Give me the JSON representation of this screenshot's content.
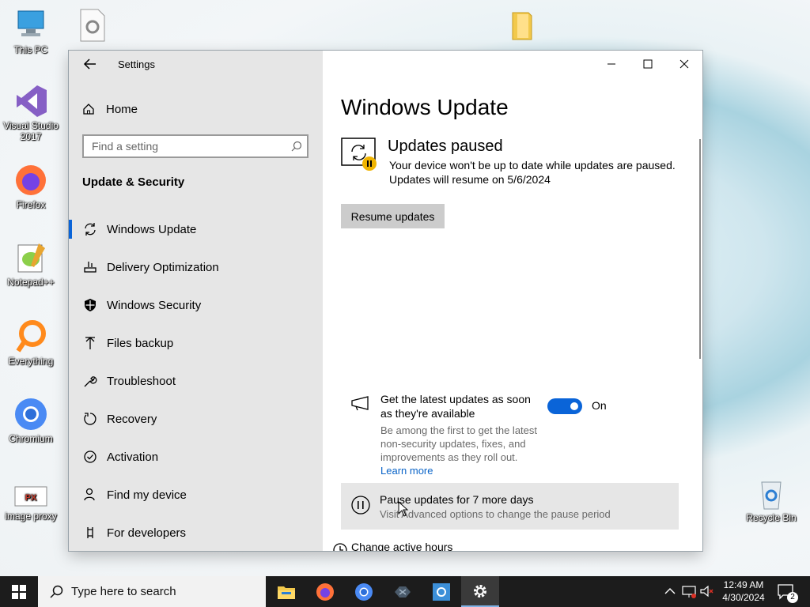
{
  "desktop": {
    "icons": [
      {
        "label": "This PC"
      },
      {
        "label": "Visual Studio 2017"
      },
      {
        "label": "Firefox"
      },
      {
        "label": "Notepad++"
      },
      {
        "label": "Everything"
      },
      {
        "label": "Chromium"
      },
      {
        "label": "image proxy"
      },
      {
        "label": "Recycle Bin"
      }
    ]
  },
  "window": {
    "title": "Settings",
    "controls": {
      "minimize": "minimize-icon",
      "maximize": "maximize-icon",
      "close": "close-icon"
    }
  },
  "sidebar": {
    "home_label": "Home",
    "search_placeholder": "Find a setting",
    "section_title": "Update & Security",
    "items": [
      {
        "label": "Windows Update",
        "icon": "sync-icon",
        "active": true
      },
      {
        "label": "Delivery Optimization",
        "icon": "delivery-icon"
      },
      {
        "label": "Windows Security",
        "icon": "shield-icon"
      },
      {
        "label": "Files backup",
        "icon": "backup-icon"
      },
      {
        "label": "Troubleshoot",
        "icon": "wrench-icon"
      },
      {
        "label": "Recovery",
        "icon": "recovery-icon"
      },
      {
        "label": "Activation",
        "icon": "check-circle-icon"
      },
      {
        "label": "Find my device",
        "icon": "person-icon"
      },
      {
        "label": "For developers",
        "icon": "developer-icon"
      }
    ]
  },
  "main": {
    "title": "Windows Update",
    "status_title": "Updates paused",
    "status_line1": "Your device won't be up to date while updates are paused.",
    "status_line2": "Updates will resume on 5/6/2024",
    "resume_button": "Resume updates",
    "latest_updates": {
      "title": "Get the latest updates as soon as they're available",
      "description": "Be among the first to get the latest non-security updates, fixes, and improvements as they roll out.",
      "learn_more": "Learn more",
      "toggle_state": "On"
    },
    "pause": {
      "title": "Pause updates for 7 more days",
      "subtitle": "Visit Advanced options to change the pause period"
    },
    "change_active_hours": "Change active hours"
  },
  "taskbar": {
    "search_placeholder": "Type here to search",
    "time": "12:49 AM",
    "date": "4/30/2024",
    "notification_count": "2"
  }
}
